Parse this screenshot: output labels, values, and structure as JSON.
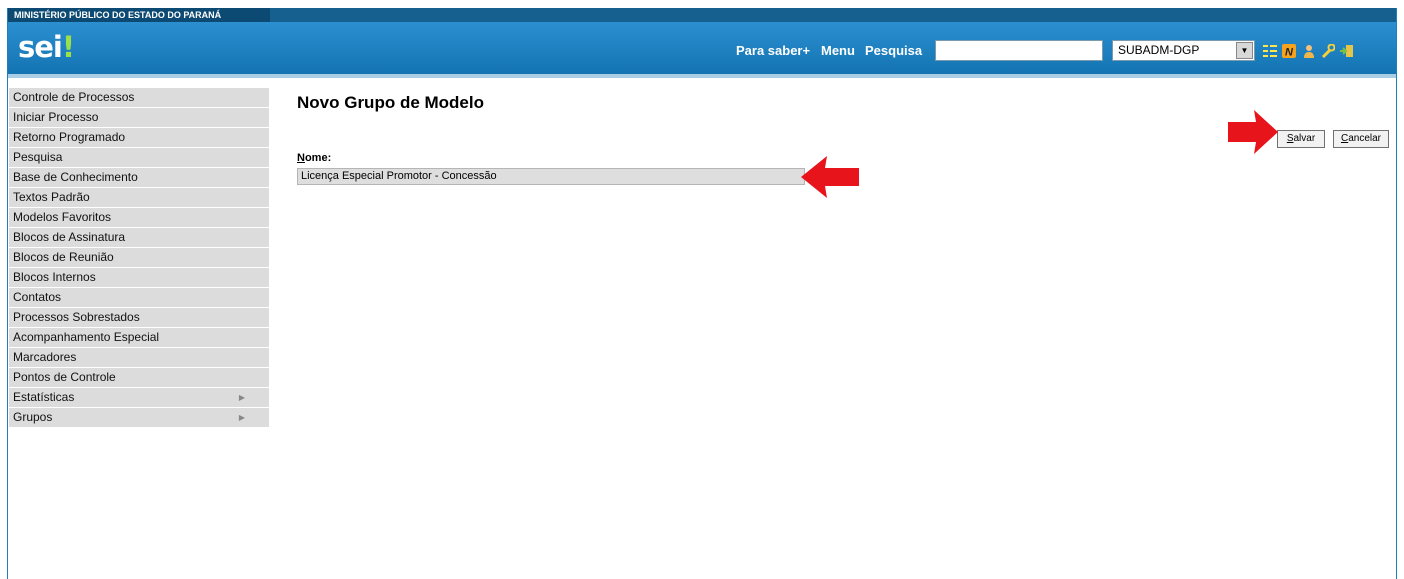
{
  "header": {
    "organization": "MINISTÉRIO PÚBLICO DO ESTADO DO PARANÁ",
    "logo_text": "sei",
    "logo_mark": "!",
    "nav": {
      "para_saber": "Para saber+",
      "menu": "Menu",
      "pesquisa": "Pesquisa"
    },
    "search_value": "",
    "unit_selected": "SUBADM-DGP",
    "icons": [
      "list-view-icon",
      "notes-icon",
      "user-icon",
      "tools-icon",
      "exit-icon"
    ]
  },
  "sidebar": {
    "items": [
      {
        "label": "Controle de Processos",
        "has_submenu": false
      },
      {
        "label": "Iniciar Processo",
        "has_submenu": false
      },
      {
        "label": "Retorno Programado",
        "has_submenu": false
      },
      {
        "label": "Pesquisa",
        "has_submenu": false
      },
      {
        "label": "Base de Conhecimento",
        "has_submenu": false
      },
      {
        "label": "Textos Padrão",
        "has_submenu": false
      },
      {
        "label": "Modelos Favoritos",
        "has_submenu": false
      },
      {
        "label": "Blocos de Assinatura",
        "has_submenu": false
      },
      {
        "label": "Blocos de Reunião",
        "has_submenu": false
      },
      {
        "label": "Blocos Internos",
        "has_submenu": false
      },
      {
        "label": "Contatos",
        "has_submenu": false
      },
      {
        "label": "Processos Sobrestados",
        "has_submenu": false
      },
      {
        "label": "Acompanhamento Especial",
        "has_submenu": false
      },
      {
        "label": "Marcadores",
        "has_submenu": false
      },
      {
        "label": "Pontos de Controle",
        "has_submenu": false
      },
      {
        "label": "Estatísticas",
        "has_submenu": true
      },
      {
        "label": "Grupos",
        "has_submenu": true
      }
    ]
  },
  "main": {
    "title": "Novo Grupo de Modelo",
    "name_label_first": "N",
    "name_label_rest": "ome:",
    "name_value": "Licença Especial Promotor - Concessão",
    "save_first": "S",
    "save_rest": "alvar",
    "cancel_first": "C",
    "cancel_rest": "ancelar"
  },
  "colors": {
    "header_blue": "#1a7fc0",
    "org_strip": "#0d4a73",
    "sidebar_bg": "#dcdcdc",
    "annotation_arrow": "#e8141b"
  }
}
